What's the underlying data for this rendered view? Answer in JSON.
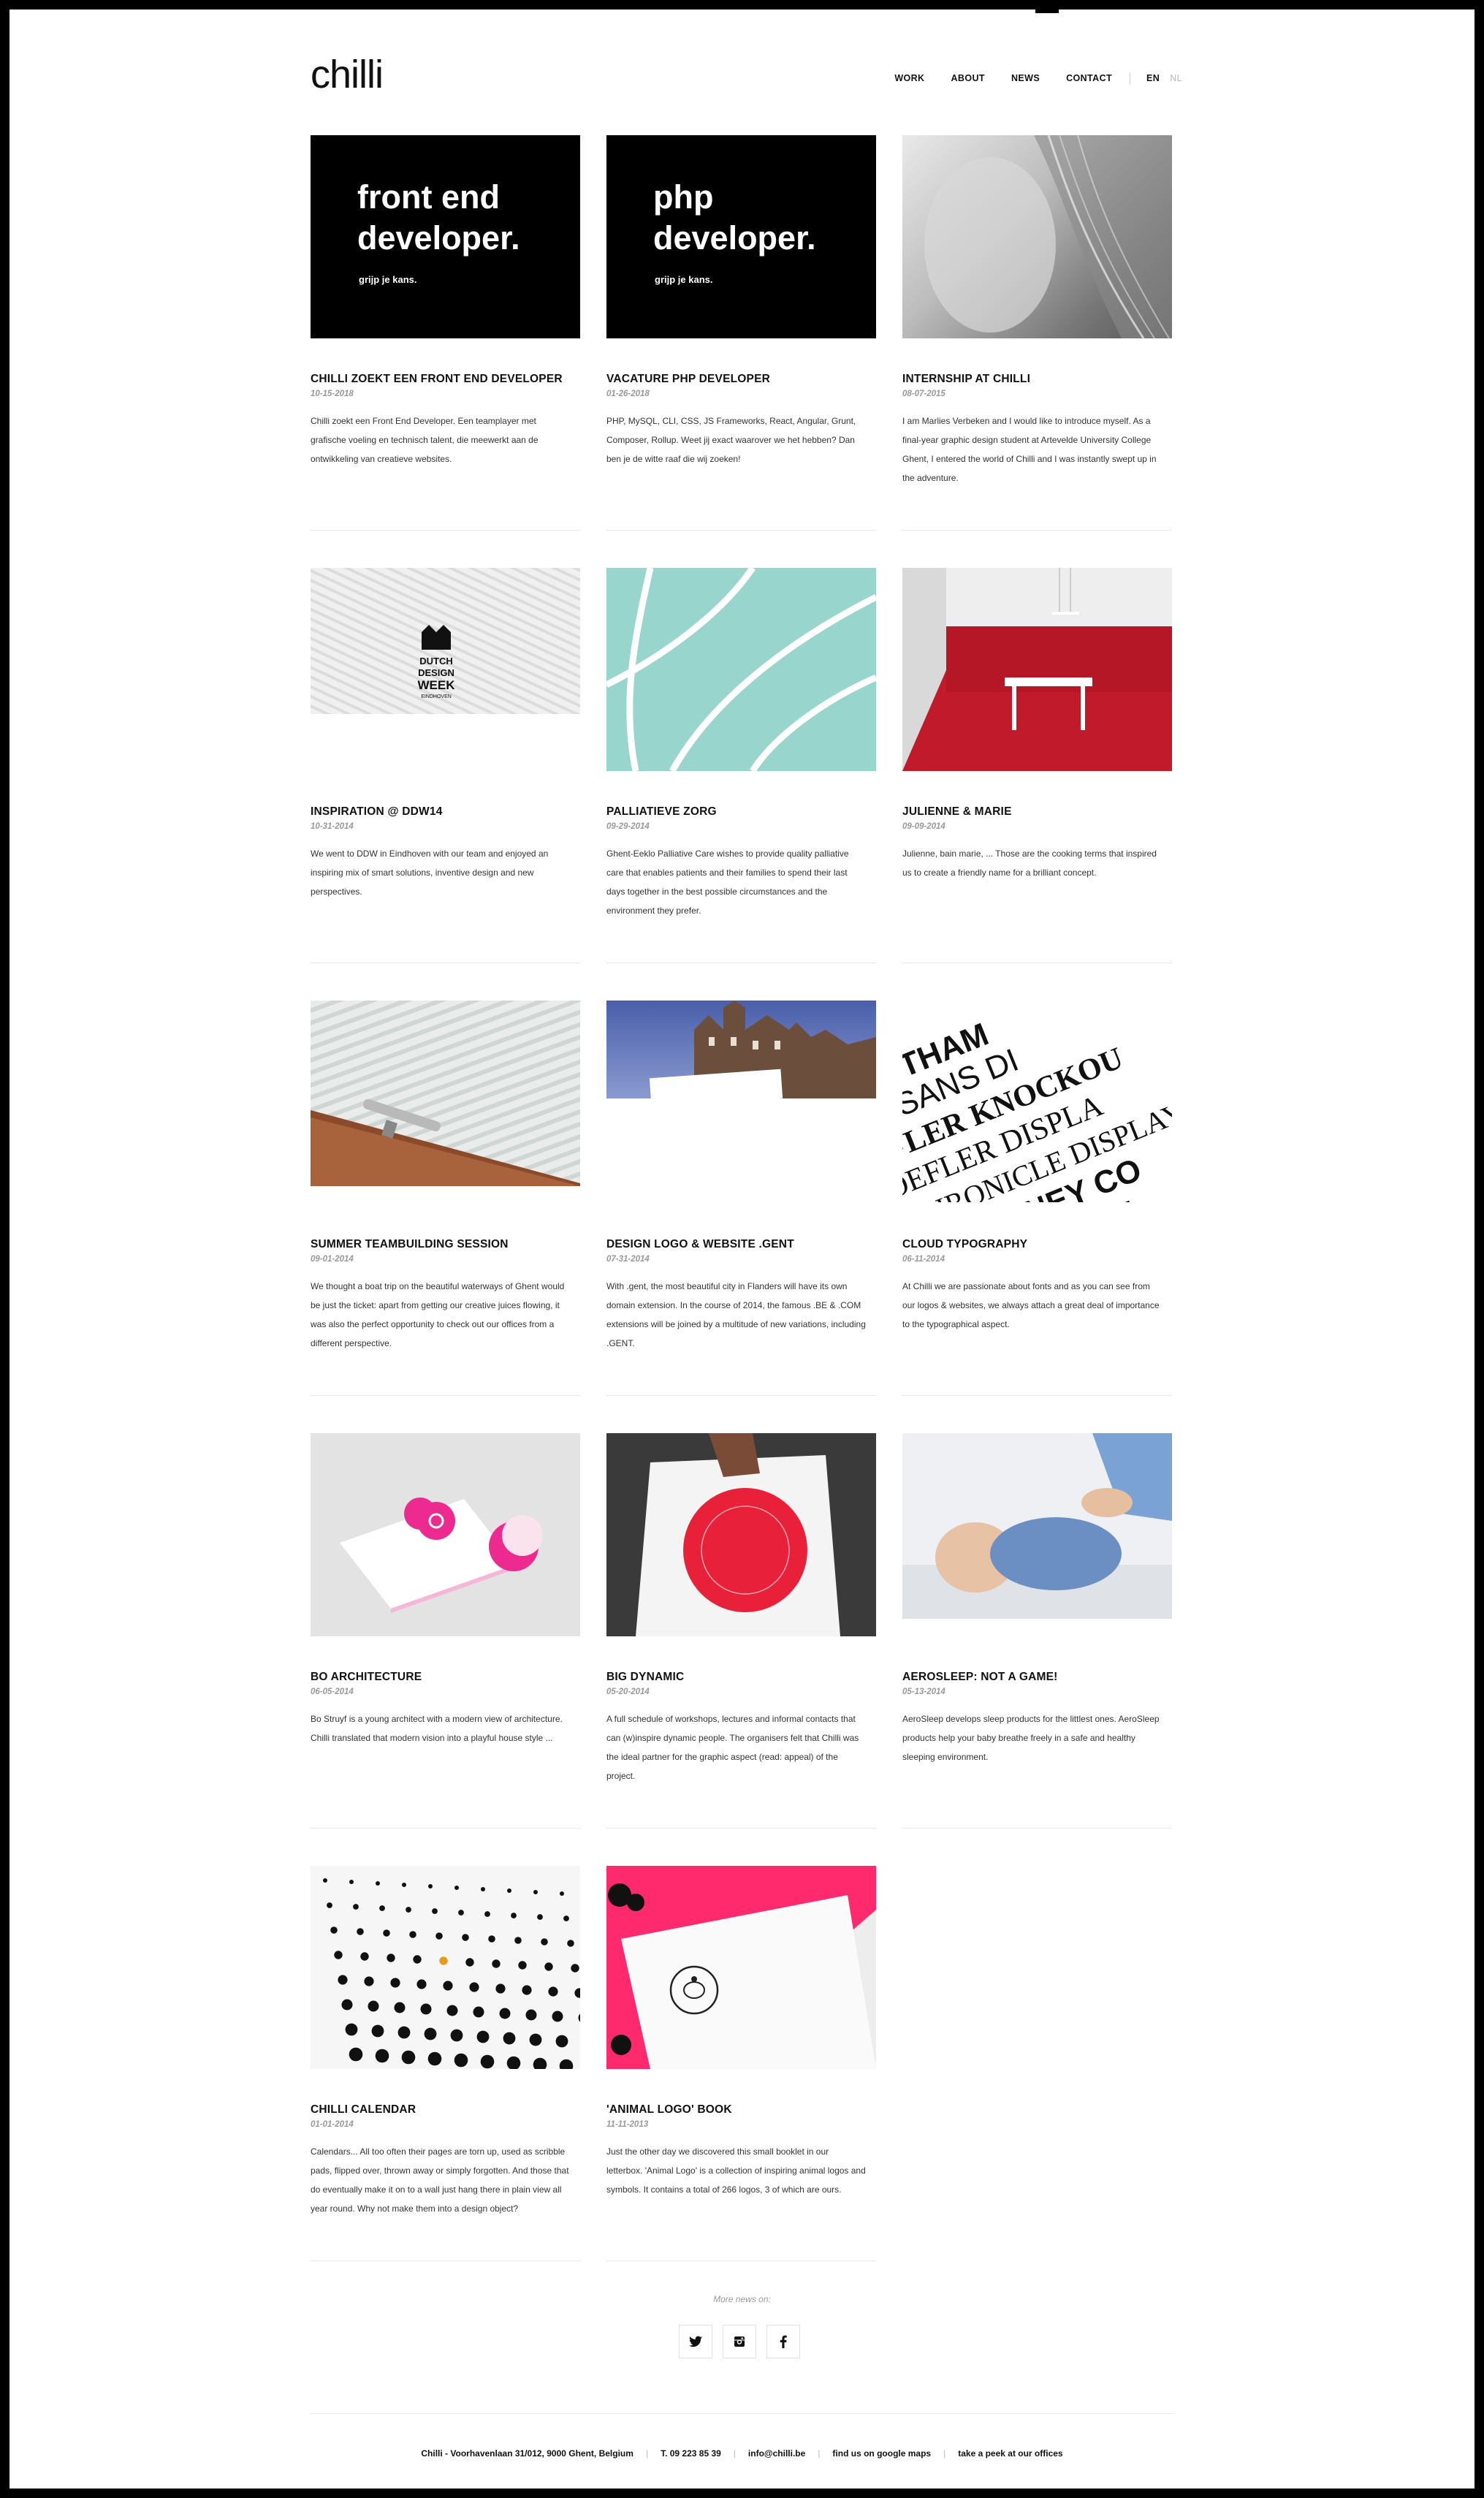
{
  "header": {
    "logo": "chilli",
    "nav": [
      "WORK",
      "ABOUT",
      "NEWS",
      "CONTACT"
    ],
    "lang_active": "EN",
    "lang_inactive": "NL"
  },
  "thumbs": {
    "t1_line1": "front end",
    "t1_line2": "developer.",
    "t1_sub": "grijp je kans.",
    "t2_line1": "php",
    "t2_line2": "developer.",
    "t2_sub": "grijp je kans.",
    "t4_l1": "DUTCH",
    "t4_l2": "DESIGN",
    "t4_l3": "WEEK",
    "t4_l4": "EINDHOVEN",
    "t9_words": [
      "GOTHAM",
      "AL SANS DI",
      "FLER KNOCKOU",
      "ROEFLER DISPLA",
      "CHRONICLE DISPLAY",
      "WHITNEY CO",
      "GOT"
    ]
  },
  "articles": [
    {
      "title": "CHILLI ZOEKT EEN FRONT END DEVELOPER",
      "date": "10-15-2018",
      "text": "Chilli zoekt een Front End Developer. Een teamplayer met grafische voeling en technisch talent, die meewerkt aan de ontwikkeling van creatieve websites."
    },
    {
      "title": "VACATURE PHP DEVELOPER",
      "date": "01-26-2018",
      "text": "PHP, MySQL, CLI, CSS, JS Frameworks, React, Angular, Grunt, Composer, Rollup. Weet jij exact waarover we het hebben? Dan ben je de witte raaf die wij zoeken!"
    },
    {
      "title": "INTERNSHIP AT CHILLI",
      "date": "08-07-2015",
      "text": "I am Marlies Verbeken and I would like to introduce myself. As a final-year graphic design student at Artevelde University College Ghent, I entered the world of Chilli and I was instantly swept up in the adventure."
    },
    {
      "title": "INSPIRATION @ DDW14",
      "date": "10-31-2014",
      "text": "We went to DDW in Eindhoven with our team and enjoyed an inspiring mix of smart solutions, inventive design and new perspectives."
    },
    {
      "title": "PALLIATIEVE ZORG",
      "date": "09-29-2014",
      "text": "Ghent-Eeklo Palliative Care wishes to provide quality palliative care that enables patients and their families to spend their last days together in the best possible circumstances and the environment they prefer."
    },
    {
      "title": "JULIENNE & MARIE",
      "date": "09-09-2014",
      "text": "Julienne, bain marie, ... Those are the cooking terms that inspired us to create a friendly name for a brilliant concept."
    },
    {
      "title": "SUMMER TEAMBUILDING SESSION",
      "date": "09-01-2014",
      "text": "We thought a boat trip on the beautiful waterways of Ghent would be just the ticket: apart from getting our creative juices flowing, it was also the perfect opportunity to check out our offices from a different perspective."
    },
    {
      "title": "DESIGN LOGO & WEBSITE .GENT",
      "date": "07-31-2014",
      "text": "With .gent, the most beautiful city in Flanders will have its own domain extension. In the course of 2014, the famous .BE & .COM extensions will be joined by a multitude of new variations, including .GENT."
    },
    {
      "title": "CLOUD TYPOGRAPHY",
      "date": "06-11-2014",
      "text": "At Chilli we are passionate about fonts and as you can see from our logos & websites, we always attach a great deal of importance to the typographical aspect."
    },
    {
      "title": "BO ARCHITECTURE",
      "date": "06-05-2014",
      "text": "Bo Struyf is a young architect with a modern view of architecture. Chilli translated that modern vision into a playful house style ..."
    },
    {
      "title": "BIG DYNAMIC",
      "date": "05-20-2014",
      "text": "A full schedule of workshops, lectures and informal contacts that can (w)inspire dynamic people. The organisers felt that Chilli was the ideal partner for the graphic aspect (read: appeal) of the project."
    },
    {
      "title": "AEROSLEEP: NOT A GAME!",
      "date": "05-13-2014",
      "text": "AeroSleep develops sleep products for the littlest ones. AeroSleep products help your baby breathe freely in a safe and healthy sleeping environment."
    },
    {
      "title": "CHILLI CALENDAR",
      "date": "01-01-2014",
      "text": "Calendars... All too often their pages are torn up, used as scribble pads, flipped over, thrown away or simply forgotten. And those that do eventually make it on to a wall just hang there in plain view all year round. Why not make them into a design object?"
    },
    {
      "title": "'ANIMAL LOGO' BOOK",
      "date": "11-11-2013",
      "text": "Just the other day we discovered this small booklet in our letterbox. 'Animal Logo' is a collection of inspiring animal logos and symbols. It contains a total of 266 logos, 3 of which are ours."
    }
  ],
  "more_news": "More news on:",
  "footer": {
    "address": "Chilli - Voorhavenlaan 31/012, 9000 Ghent, Belgium",
    "phone": "T. 09 223 85 39",
    "email": "info@chilli.be",
    "maps": "find us on google maps",
    "offices": "take a peek at our offices"
  }
}
